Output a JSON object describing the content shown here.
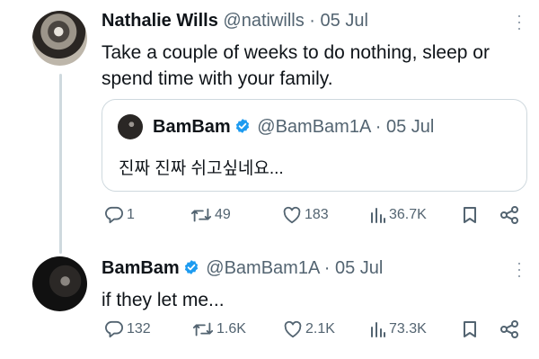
{
  "tweet1": {
    "name": "Nathalie Wills",
    "handle_date": "@natiwills · 05 Jul",
    "text": "Take a couple of weeks to do nothing, sleep or spend time with your family.",
    "avatar_icon": "profile-photo",
    "quote": {
      "name": "BamBam",
      "handle_date": "@BamBam1A · 05 Jul",
      "text": "진짜 진짜 쉬고싶네요..."
    },
    "stats": {
      "replies": "1",
      "reposts": "49",
      "likes": "183",
      "views": "36.7K"
    }
  },
  "tweet2": {
    "name": "BamBam",
    "handle_date": "@BamBam1A · 05 Jul",
    "text": "if they let me...",
    "avatar_icon": "profile-photo",
    "stats": {
      "replies": "132",
      "reposts": "1.6K",
      "likes": "2.1K",
      "views": "73.3K"
    }
  },
  "colors": {
    "verified": "#1d9bf0",
    "muted": "#536471",
    "thread_line": "#cfd9de"
  },
  "icons": [
    "reply-icon",
    "repost-icon",
    "like-icon",
    "views-icon",
    "bookmark-icon",
    "share-icon",
    "more-icon",
    "verified-badge-icon"
  ]
}
